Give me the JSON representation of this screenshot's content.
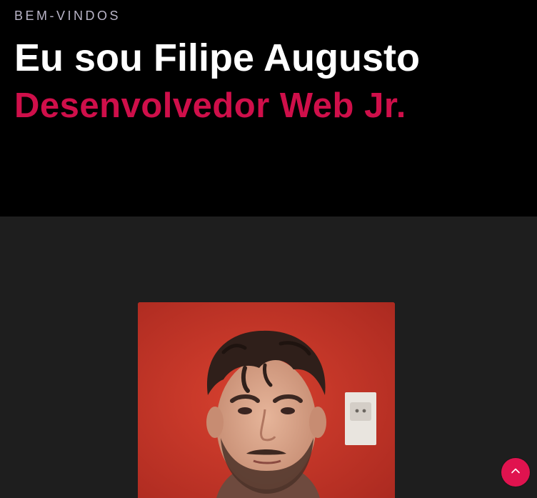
{
  "hero": {
    "eyebrow": "BEM-VINDOS",
    "headline": "Eu sou Filipe Augusto",
    "subheadline": "Desenvolvedor Web Jr."
  },
  "about": {
    "photo_icon": "profile-photo"
  },
  "scroll_top": {
    "icon": "chevron-up-icon"
  },
  "colors": {
    "hero_background": "#000000",
    "section_background": "#1e1e1e",
    "accent": "#cf0f4a",
    "eyebrow_text": "#b9b4c7",
    "headline_text": "#ffffff",
    "scroll_button": "#e0134f"
  }
}
